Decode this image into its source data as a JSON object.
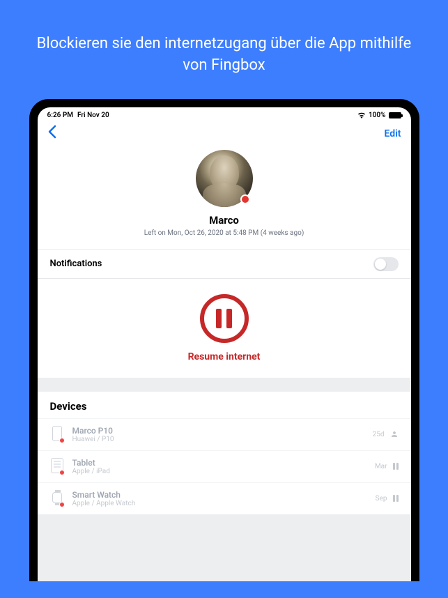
{
  "headline": "Blockieren sie den internetzugang über die App mithilfe von Fingbox",
  "status_bar": {
    "time": "6:26 PM",
    "date": "Fri Nov 20",
    "battery": "100%"
  },
  "nav": {
    "edit_label": "Edit"
  },
  "profile": {
    "name": "Marco",
    "subtitle": "Left on Mon, Oct 26, 2020 at 5:48 PM (4 weeks ago)"
  },
  "notifications": {
    "label": "Notifications"
  },
  "pause": {
    "label": "Resume internet"
  },
  "devices": {
    "header": "Devices",
    "items": [
      {
        "name": "Marco P10",
        "sub": "Huawei / P10",
        "meta": "25d",
        "icon": "phone",
        "right_icon": "person"
      },
      {
        "name": "Tablet",
        "sub": "Apple / iPad",
        "meta": "Mar",
        "icon": "tablet",
        "right_icon": "pause"
      },
      {
        "name": "Smart Watch",
        "sub": "Apple / Apple Watch",
        "meta": "Sep",
        "icon": "watch",
        "right_icon": "pause"
      }
    ]
  }
}
